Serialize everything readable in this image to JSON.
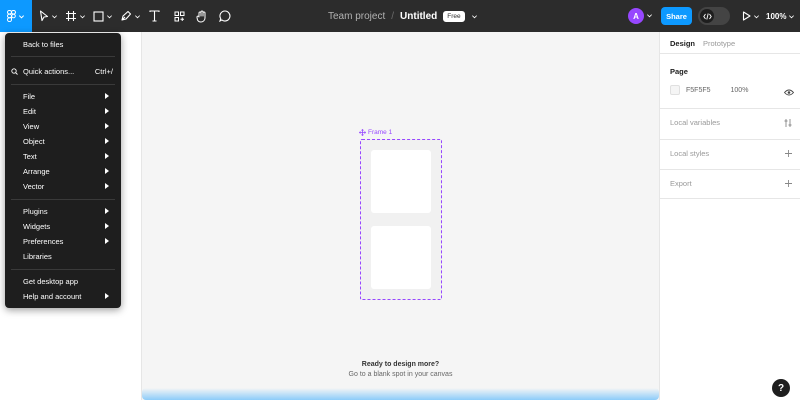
{
  "toolbar": {
    "team_name": "Team project",
    "separator": "/",
    "file_name": "Untitled",
    "plan_badge": "Free",
    "avatar_initial": "A",
    "share_label": "Share",
    "zoom_level": "100%",
    "accent_color": "#0d99ff",
    "tools": [
      "move-tool-icon",
      "frame-tool-icon",
      "shape-tool-icon",
      "pen-tool-icon",
      "text-tool-icon",
      "resources-icon",
      "hand-tool-icon",
      "comment-icon"
    ]
  },
  "menu": {
    "back": "Back to files",
    "quick_actions": "Quick actions...",
    "quick_actions_shortcut": "Ctrl+/",
    "group1": [
      "File",
      "Edit",
      "View",
      "Object",
      "Text",
      "Arrange",
      "Vector"
    ],
    "group2": [
      "Plugins",
      "Widgets",
      "Preferences",
      "Libraries"
    ],
    "desktop": "Get desktop app",
    "help": "Help and account"
  },
  "canvas": {
    "frame_label": "Frame 1",
    "ready_title": "Ready to design more?",
    "ready_subtitle": "Go to a blank spot in your canvas"
  },
  "right_panel": {
    "tab_design": "Design",
    "tab_prototype": "Prototype",
    "page_heading": "Page",
    "page_color": "F5F5F5",
    "page_opacity": "100%",
    "local_variables": "Local variables",
    "local_styles": "Local styles",
    "export": "Export"
  },
  "help_button": "?"
}
